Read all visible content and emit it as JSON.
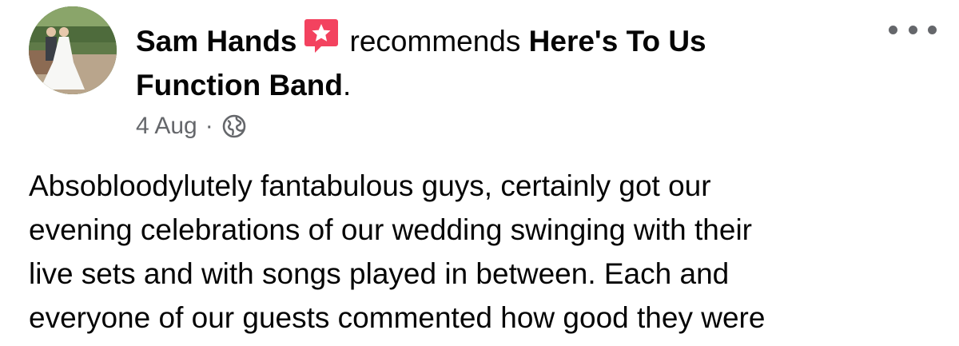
{
  "post": {
    "author": "Sam Hands",
    "action": "recommends",
    "page_name_line1": "Here's To Us",
    "page_name_line2": "Function Band",
    "period": ".",
    "date": "4 Aug",
    "separator": "·",
    "privacy_icon": "globe-icon",
    "recommend_icon": "recommend-star-icon",
    "more_icon": "more-options-icon",
    "body_lines": [
      "Absobloodylutely fantabulous guys, certainly got our",
      "evening celebrations of our wedding swinging with their",
      "live sets and with songs played in between. Each and",
      "everyone of our guests commented how good they were"
    ]
  },
  "colors": {
    "text_primary": "#050505",
    "text_secondary": "#65676b",
    "recommend_badge": "#f3425f"
  }
}
